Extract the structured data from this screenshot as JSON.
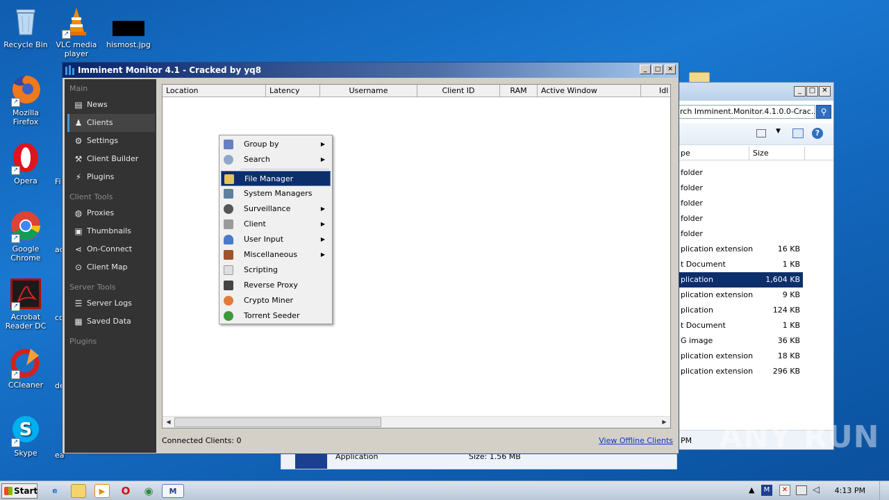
{
  "desktop": {
    "icons": [
      {
        "label": "Recycle Bin"
      },
      {
        "label": "VLC media player"
      },
      {
        "label": "hismost.jpg"
      },
      {
        "label": "Mozilla Firefox"
      },
      {
        "label": "Opera"
      },
      {
        "label": "Google Chrome"
      },
      {
        "label": "Acrobat Reader DC"
      },
      {
        "label": "CCleaner"
      },
      {
        "label": "Skype"
      }
    ],
    "partial_labels": [
      "Fi",
      "ad",
      "cc",
      "de",
      "ea"
    ]
  },
  "explorer": {
    "search_text": "rch Imminent.Monitor.4.1.0.0-Crac...",
    "headers": {
      "type": "pe",
      "size": "Size"
    },
    "rows": [
      {
        "type": "folder",
        "size": ""
      },
      {
        "type": "folder",
        "size": ""
      },
      {
        "type": "folder",
        "size": ""
      },
      {
        "type": "folder",
        "size": ""
      },
      {
        "type": "folder",
        "size": ""
      },
      {
        "type": "plication extension",
        "size": "16 KB"
      },
      {
        "type": "t Document",
        "size": "1 KB"
      },
      {
        "type": "plication",
        "size": "1,604 KB"
      },
      {
        "type": "plication extension",
        "size": "9 KB"
      },
      {
        "type": "plication",
        "size": "124 KB"
      },
      {
        "type": "t Document",
        "size": "1 KB"
      },
      {
        "type": "G image",
        "size": "36 KB"
      },
      {
        "type": "plication extension",
        "size": "18 KB"
      },
      {
        "type": "plication extension",
        "size": "296 KB"
      }
    ],
    "selected_row": 7,
    "status_partial": "PM",
    "details_type": "Application",
    "details_size": "Size: 1.56 MB"
  },
  "window": {
    "title": "Imminent Monitor 4.1 - Cracked by yq8",
    "buttons": {
      "minimize": "_",
      "maximize": "□",
      "close": "✕"
    }
  },
  "sidebar": {
    "sections": [
      {
        "label": "Main",
        "items": [
          {
            "label": "News",
            "icon": "news-icon",
            "glyph": "▤"
          },
          {
            "label": "Clients",
            "icon": "users-icon",
            "glyph": "👥",
            "active": true
          },
          {
            "label": "Settings",
            "icon": "gear-icon",
            "glyph": "⚙"
          },
          {
            "label": "Client Builder",
            "icon": "hammer-icon",
            "glyph": "🔨"
          },
          {
            "label": "Plugins",
            "icon": "plug-icon",
            "glyph": "⚡"
          }
        ]
      },
      {
        "label": "Client Tools",
        "items": [
          {
            "label": "Proxies",
            "icon": "globe-icon",
            "glyph": "◍"
          },
          {
            "label": "Thumbnails",
            "icon": "image-icon",
            "glyph": "▣"
          },
          {
            "label": "On-Connect",
            "icon": "share-icon",
            "glyph": "⋖"
          },
          {
            "label": "Client Map",
            "icon": "map-pin-icon",
            "glyph": "⊙"
          }
        ]
      },
      {
        "label": "Server Tools",
        "items": [
          {
            "label": "Server Logs",
            "icon": "logs-icon",
            "glyph": "☰"
          },
          {
            "label": "Saved Data",
            "icon": "save-icon",
            "glyph": "▦"
          }
        ]
      },
      {
        "label": "Plugins",
        "items": []
      }
    ]
  },
  "clients_table": {
    "columns": [
      "Location",
      "Latency",
      "Username",
      "Client ID",
      "RAM",
      "Active Window",
      "Idl"
    ]
  },
  "status": {
    "connected": "Connected Clients: 0",
    "offline_link": "View Offline Clients"
  },
  "context_menu": {
    "items": [
      {
        "label": "Group by",
        "icon": "group-icon",
        "color": "#6a7fbf",
        "submenu": true
      },
      {
        "label": "Search",
        "icon": "magnifier-icon",
        "color": "#8fa8c8",
        "submenu": true
      },
      {
        "separator": true
      },
      {
        "label": "File Manager",
        "icon": "folder-icon",
        "color": "#e8c25a",
        "submenu": false,
        "highlighted": true
      },
      {
        "label": "System Managers",
        "icon": "monitor-icon",
        "color": "#5f7f9f",
        "submenu": false
      },
      {
        "label": "Surveillance",
        "icon": "camera-icon",
        "color": "#555555",
        "submenu": true
      },
      {
        "label": "Client",
        "icon": "wrench-icon",
        "color": "#9a9a9a",
        "submenu": true
      },
      {
        "label": "User Input",
        "icon": "user-icon",
        "color": "#4a7ac8",
        "submenu": true
      },
      {
        "label": "Miscellaneous",
        "icon": "briefcase-icon",
        "color": "#a0522d",
        "submenu": true
      },
      {
        "label": "Scripting",
        "icon": "document-icon",
        "color": "#dedede",
        "submenu": false
      },
      {
        "label": "Reverse Proxy",
        "icon": "tool-icon",
        "color": "#444444",
        "submenu": false
      },
      {
        "label": "Crypto Miner",
        "icon": "coin-icon",
        "color": "#e07b39",
        "submenu": false
      },
      {
        "label": "Torrent Seeder",
        "icon": "torrent-icon",
        "color": "#3a9a3a",
        "submenu": false
      }
    ]
  },
  "taskbar": {
    "start_label": "Start",
    "clock": "4:13 PM"
  },
  "watermark": "ANY RUN"
}
